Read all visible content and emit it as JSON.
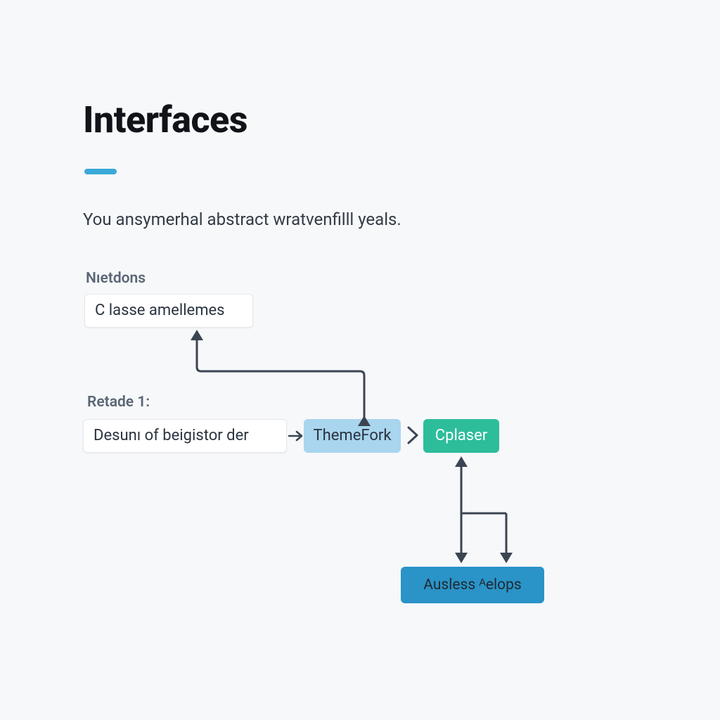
{
  "title": "Interfaces",
  "subtitle": "You ansymerhal abstract wratvenfilll yeals.",
  "labels": {
    "nietdons": "Nıetdons",
    "retade": "Retade 1:"
  },
  "nodes": {
    "classe": {
      "text": "C lasse amellemes",
      "kind": "white"
    },
    "desunt": {
      "text": "Desunı of beigistor der",
      "kind": "white"
    },
    "themefork": {
      "text": "ThemeFork",
      "kind": "blue"
    },
    "cplaser": {
      "text": "Cplaser",
      "kind": "green"
    },
    "ausless": {
      "text": "Ausless ᴬelops",
      "kind": "darkblue"
    }
  },
  "colors": {
    "accent": "#3aa9d7",
    "node_blue": "#a9d5ee",
    "node_green": "#2dbd9b",
    "node_darkblue": "#2a93c7",
    "arrow": "#3b4552"
  },
  "edges": [
    {
      "from": "themefork",
      "to": "classe",
      "style": "elbow-up-left-arrows-both-ends"
    },
    {
      "from": "desunt",
      "to": "themefork",
      "style": "inline-right-arrow"
    },
    {
      "from": "themefork",
      "to": "cplaser",
      "style": "inline-chevron-right"
    },
    {
      "from": "cplaser",
      "to": "ausless",
      "style": "two-way-down"
    }
  ]
}
